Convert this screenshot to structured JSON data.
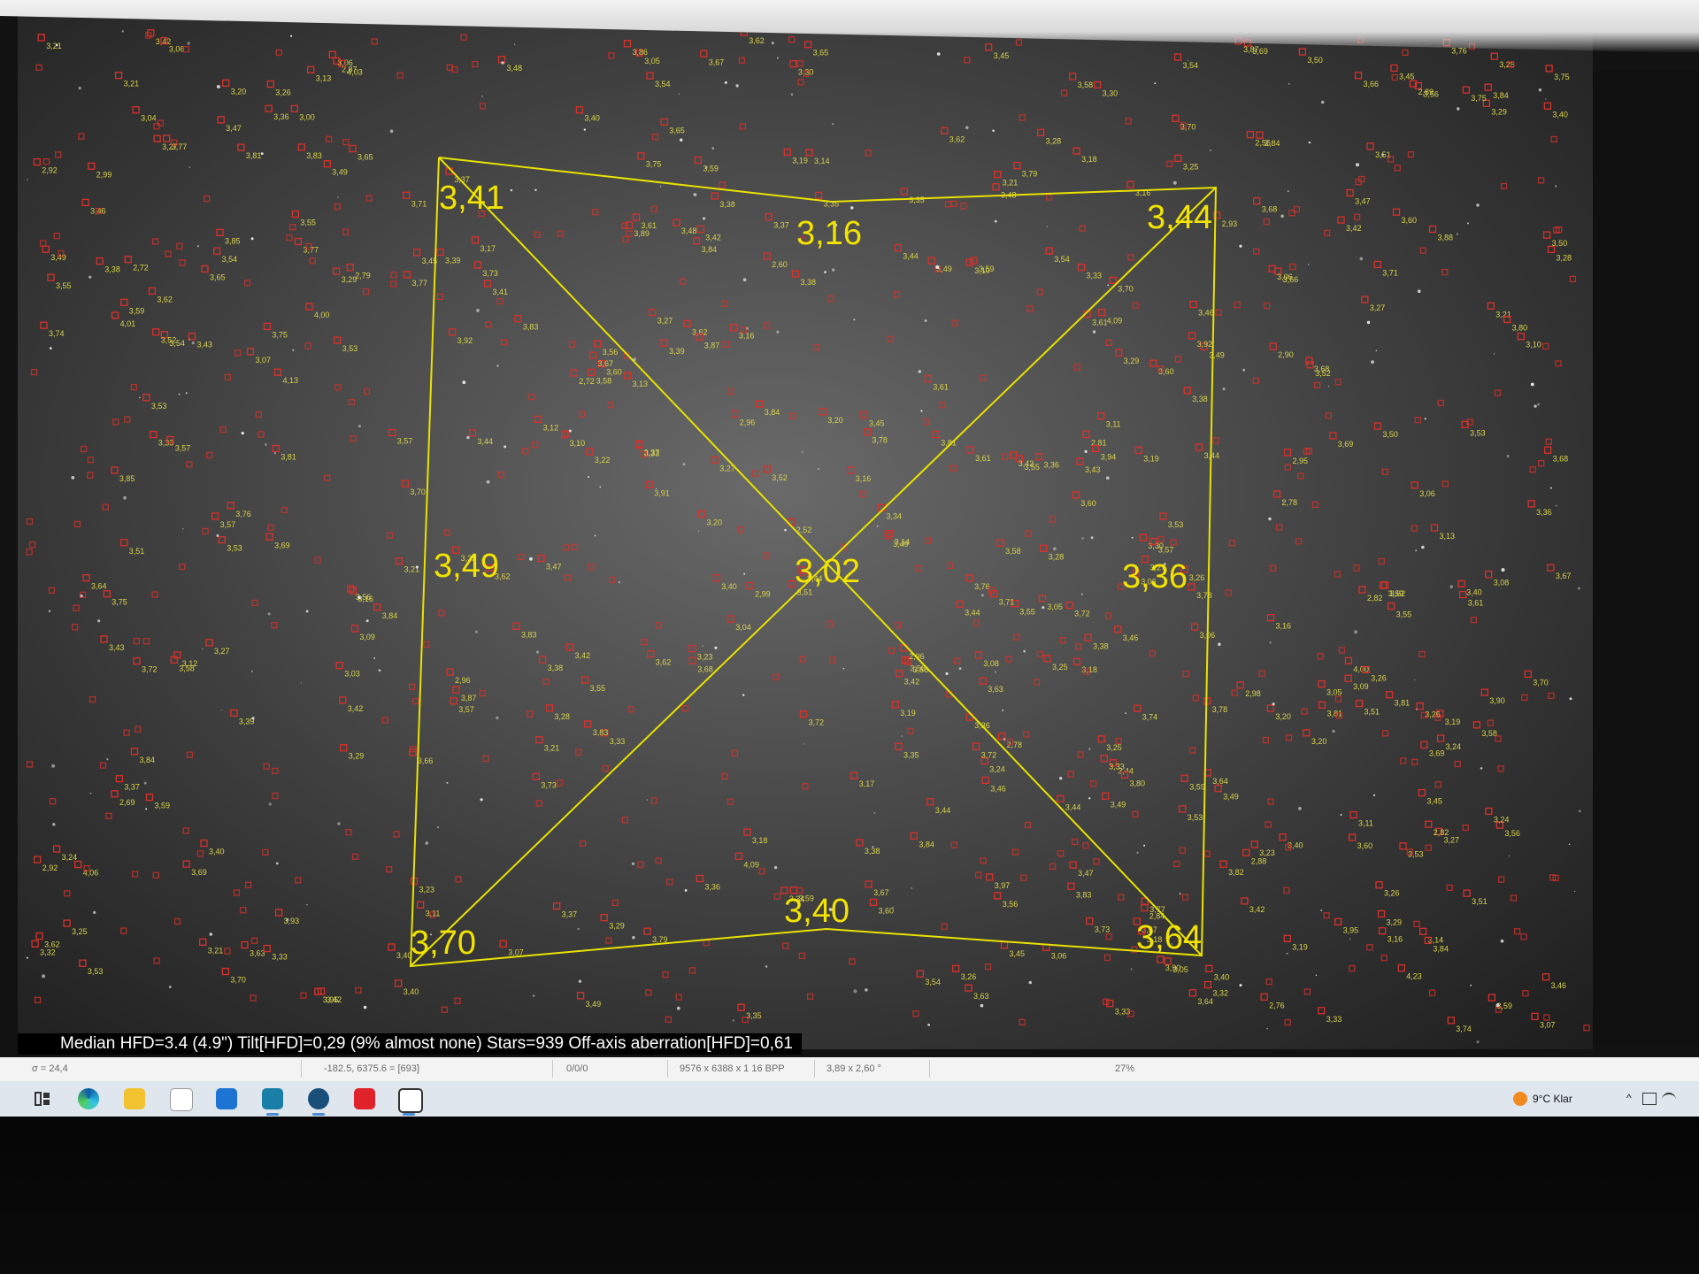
{
  "stats": {
    "summary": "Median HFD=3.4 (4.9\")  Tilt[HFD]=0,29 (9% almost none)  Stars=939  Off-axis aberration[HFD]=0,61"
  },
  "statusbar": {
    "sigma": "σ = 24,4",
    "coords": "-182.5, 6375.6 = [693]",
    "rgb": "0/0/0",
    "dimensions": "9576 x 6388 x 1   16 BPP",
    "scale": "3,89 x 2,60 °",
    "zoom": "27%"
  },
  "tray": {
    "weather": "9°C  Klar",
    "chevron": "^"
  },
  "tilt": {
    "top_left": "3,41",
    "top": "3,16",
    "top_right": "3,44",
    "left": "3,49",
    "center": "3,02",
    "right": "3,36",
    "bottom_left": "3,70",
    "bottom": "3,40",
    "bottom_right": "3,64"
  },
  "star_labels": [
    "3,32",
    "3,17",
    "3,27",
    "3,73",
    "3,26",
    "3,18",
    "3,66",
    "3,33",
    "3,30",
    "3,60",
    "3,27",
    "3,53",
    "3,19",
    "3,55",
    "3,14",
    "3,60",
    "3,68",
    "3,75",
    "3,62",
    "3,40",
    "3,77",
    "3,59",
    "3,49",
    "3,48",
    "3,56",
    "3,58",
    "3,06",
    "3,35",
    "3,27",
    "3,22",
    "3,47",
    "3,10",
    "3,06",
    "4,00",
    "3,58",
    "3,72",
    "3,53",
    "3,70",
    "3,61",
    "3,12",
    "3,42",
    "3,40",
    "3,33",
    "3,36",
    "3,28",
    "3,21",
    "3,04",
    "3,63",
    "3,29",
    "3,16",
    "3,46",
    "3,55",
    "3,42",
    "3,59",
    "3,53",
    "3,33",
    "3,71",
    "3,29",
    "3,57",
    "3,62",
    "3,45",
    "3,25",
    "3,42",
    "3,19",
    "3,39",
    "3,16",
    "2,69",
    "3,25",
    "3,30",
    "3,21",
    "3,39",
    "3,45",
    "3,26",
    "3,46",
    "3,44",
    "3,66",
    "3,50",
    "3,57",
    "3,62",
    "3,42",
    "3,60",
    "3,19",
    "3,53",
    "3,07",
    "3,56",
    "3,88",
    "3,79",
    "3,51",
    "3,40",
    "3,37",
    "3,38",
    "3,28",
    "3,14",
    "3,38",
    "3,54",
    "3,62",
    "3,29",
    "3,73",
    "3,36",
    "3,59",
    "3,19",
    "3,26",
    "3,25",
    "3,06",
    "3,57",
    "2,99",
    "3,27",
    "3,06",
    "3,26",
    "3,49",
    "3,42",
    "3,70",
    "3,68",
    "3,44",
    "3,37",
    "2,72",
    "2,76",
    "3,33",
    "3,14",
    "3,09",
    "3,00",
    "2,96",
    "3,34",
    "3,40",
    "3,39",
    "3,21",
    "3,65",
    "3,40",
    "3,49",
    "3,36",
    "3,56",
    "3,05",
    "3,10",
    "2,52",
    "3,35",
    "3,25",
    "2,84",
    "3,33",
    "3,20",
    "3,59",
    "3,40",
    "3,37",
    "3,44",
    "3,24",
    "2,79",
    "2,56",
    "2,82",
    "2,78",
    "3,16",
    "2,82",
    "3,27",
    "3,43",
    "3,61",
    "3,49",
    "3,53",
    "3,28",
    "3,51",
    "3,07",
    "2,92",
    "3,05",
    "3,73",
    "3,77",
    "3,58",
    "3,83",
    "3,45",
    "3,16",
    "3,25",
    "3,21",
    "3,08",
    "3,44",
    "3,33",
    "3,62",
    "3,43",
    "3,84",
    "3,45",
    "3,08",
    "3,06",
    "2,89",
    "2,81",
    "2,98",
    "2,84",
    "3,13",
    "2,95",
    "3,11",
    "3,18",
    "3,42",
    "3,16",
    "3,70",
    "3,84",
    "3,62",
    "3,51",
    "3,21",
    "2,87",
    "2,99",
    "3,07",
    "2,60",
    "3,21",
    "3,12",
    "3,18",
    "3,30",
    "3,11",
    "3,63",
    "3,32",
    "3,46",
    "3,68",
    "3,84",
    "3,55",
    "3,45",
    "3,19",
    "3,04",
    "2,72",
    "3,03",
    "3,20",
    "2,92",
    "3,66",
    "3,49",
    "3,79",
    "3,69",
    "3,50",
    "3,42",
    "3,46",
    "3,59",
    "3,23",
    "2,90",
    "3,16",
    "3,11",
    "3,51",
    "3,59",
    "3,40",
    "3,64",
    "3,61",
    "3,29",
    "3,47",
    "3,05",
    "2,78",
    "2,88",
    "3,38",
    "3,06",
    "3,84",
    "3,97",
    "3,60",
    "3,56",
    "2,96",
    "3,17",
    "3,20",
    "3,38",
    "3,49",
    "3,41",
    "3,76",
    "3,61",
    "3,83",
    "3,88",
    "3,35",
    "3,65",
    "3,38",
    "3,26",
    "3,13",
    "3,75",
    "3,26",
    "3,84",
    "3,58",
    "3,91",
    "3,69",
    "3,92",
    "3,85",
    "3,42",
    "3,44",
    "3,53",
    "3,34",
    "3,18",
    "3,24",
    "3,55",
    "3,80",
    "3,75",
    "3,43",
    "3,95",
    "3,06",
    "3,21",
    "2,93",
    "3,20",
    "3,54",
    "3,48",
    "3,57",
    "3,36",
    "3,58",
    "3,33",
    "3,81",
    "3,44",
    "3,71",
    "3,67",
    "3,09",
    "3,10",
    "3,05",
    "2,96",
    "3,29",
    "3,27",
    "3,75",
    "3,82",
    "3,54",
    "3,61",
    "3,83",
    "3,53",
    "3,68",
    "3,44",
    "3,23",
    "4,23",
    "4,09",
    "3,70",
    "3,62",
    "4,01",
    "4,06",
    "3,65",
    "3,54",
    "3,37",
    "3,92",
    "3,46",
    "3,24",
    "3,45",
    "3,29",
    "3,13",
    "3,36",
    "3,32",
    "3,20",
    "3,87",
    "3,27",
    "3,70",
    "3,44",
    "3,78",
    "3,48",
    "3,74",
    "3,72",
    "3,93",
    "4,13",
    "3,94",
    "3,35",
    "3,40",
    "3,28",
    "3,55",
    "3,52",
    "3,67",
    "3,76",
    "3,65",
    "3,38",
    "3,84",
    "3,72",
    "3,59",
    "3,50",
    "3,69",
    "3,81",
    "3,47",
    "3,57",
    "3,62",
    "3,47",
    "3,51",
    "3,54",
    "3,55",
    "3,77",
    "3,80",
    "3,83",
    "4,00",
    "3,78",
    "3,81",
    "3,60",
    "3,69",
    "3,49",
    "3,90",
    "3,40",
    "3,24",
    "3,42",
    "3,60",
    "3,52",
    "3,64",
    "3,38",
    "3,74",
    "3,78",
    "3,64",
    "3,76",
    "3,90",
    "3,67",
    "3,84",
    "3,37",
    "3,83",
    "3,57",
    "3,52",
    "3,56",
    "3,86",
    "3,33",
    "3,23",
    "3,85",
    "3,50",
    "3,81",
    "3,54",
    "3,87",
    "3,95",
    "3,59",
    "3,81",
    "4,09",
    "3,87",
    "3,89",
    "3,49",
    "3,63",
    "3,53",
    "3,77",
    "3,74",
    "3,72",
    "3,75",
    "3,71",
    "3,67",
    "4,03",
    "3,69"
  ]
}
